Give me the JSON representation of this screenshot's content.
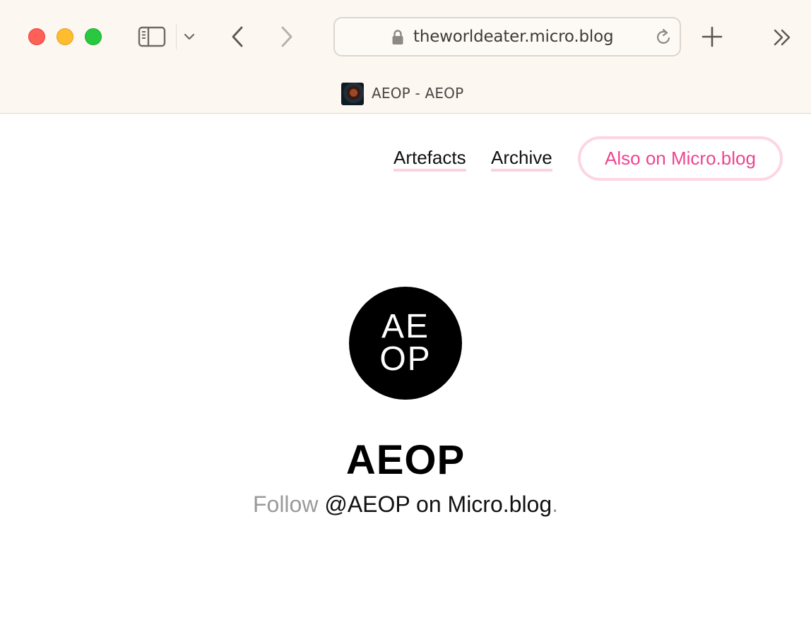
{
  "browser": {
    "url": "theworldeater.micro.blog",
    "tab_title": "AEOP - AEOP"
  },
  "nav": {
    "links": [
      {
        "label": "Artefacts"
      },
      {
        "label": "Archive"
      }
    ],
    "cta_label": "Also on Micro.blog"
  },
  "profile": {
    "avatar_line1": "AE",
    "avatar_line2": "OP",
    "title": "AEOP",
    "follow_word": "Follow",
    "follow_handle": "@AEOP on Micro.blog",
    "follow_end": "."
  },
  "colors": {
    "accent_pink": "#ed4690",
    "underline_pink": "#fbd3e2",
    "chrome_bg": "#fcf7f1"
  }
}
